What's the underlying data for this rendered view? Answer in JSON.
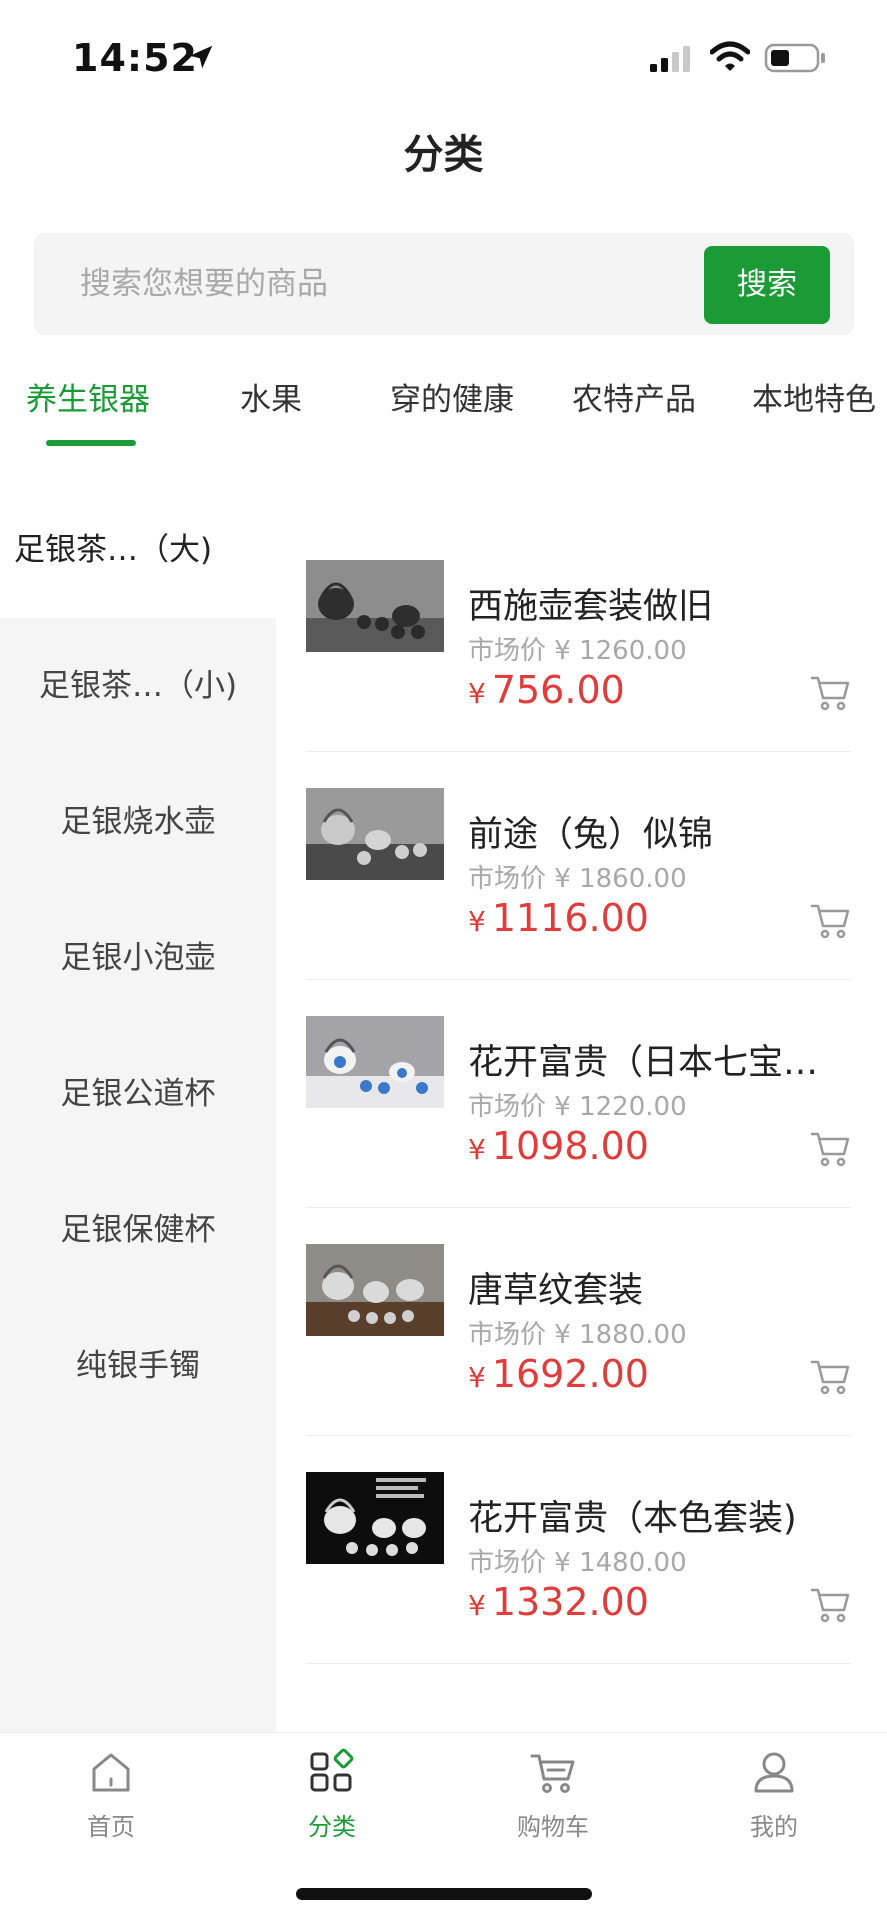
{
  "status_bar": {
    "time": "14:52"
  },
  "header": {
    "title": "分类"
  },
  "search": {
    "placeholder": "搜索您想要的商品",
    "button_label": "搜索"
  },
  "tabs": [
    {
      "label": "养生银器",
      "active": true
    },
    {
      "label": "水果"
    },
    {
      "label": "穿的健康"
    },
    {
      "label": "农特产品"
    },
    {
      "label": "本地特色"
    }
  ],
  "sidebar": {
    "items": [
      {
        "label": "足银茶…（大)",
        "active": true
      },
      {
        "label": "足银茶…（小)"
      },
      {
        "label": "足银烧水壶"
      },
      {
        "label": "足银小泡壶"
      },
      {
        "label": "足银公道杯"
      },
      {
        "label": "足银保健杯"
      },
      {
        "label": "纯银手镯"
      }
    ]
  },
  "products": [
    {
      "name": "西施壶套装做旧",
      "market_label": "市场价",
      "market_price": "¥ 1260.00",
      "currency": "¥",
      "price": "756.00"
    },
    {
      "name": "前途（兔）似锦",
      "market_label": "市场价",
      "market_price": "¥ 1860.00",
      "currency": "¥",
      "price": "1116.00"
    },
    {
      "name": "花开富贵（日本七宝…",
      "market_label": "市场价",
      "market_price": "¥ 1220.00",
      "currency": "¥",
      "price": "1098.00"
    },
    {
      "name": "唐草纹套装",
      "market_label": "市场价",
      "market_price": "¥ 1880.00",
      "currency": "¥",
      "price": "1692.00"
    },
    {
      "name": "花开富贵（本色套装)",
      "market_label": "市场价",
      "market_price": "¥ 1480.00",
      "currency": "¥",
      "price": "1332.00"
    }
  ],
  "bottom_nav": [
    {
      "label": "首页",
      "icon": "home-icon"
    },
    {
      "label": "分类",
      "icon": "category-icon",
      "active": true
    },
    {
      "label": "购物车",
      "icon": "cart-icon"
    },
    {
      "label": "我的",
      "icon": "user-icon"
    }
  ],
  "colors": {
    "accent": "#1a9b36",
    "price": "#e03c3c"
  }
}
